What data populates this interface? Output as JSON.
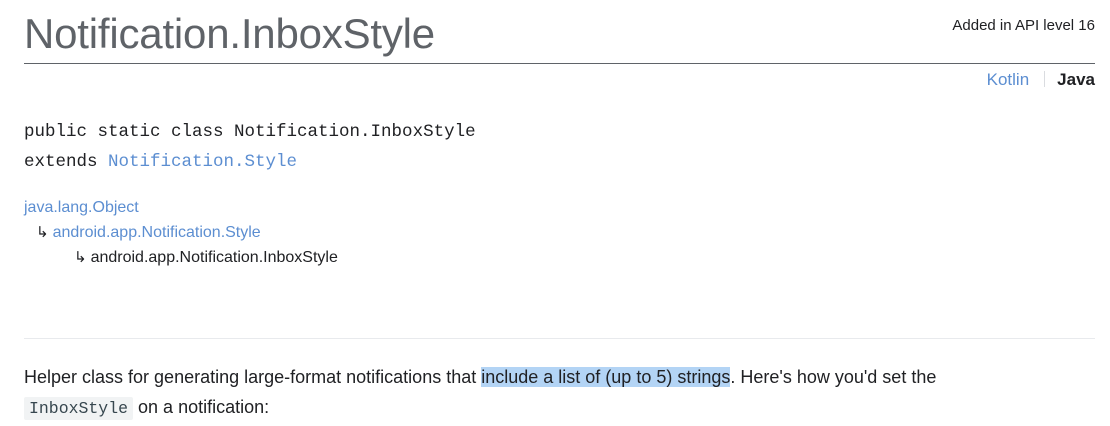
{
  "header": {
    "title": "Notification.InboxStyle",
    "api_level": "Added in API level 16"
  },
  "language_switch": {
    "kotlin": "Kotlin",
    "java": "Java",
    "selected": "Java"
  },
  "signature": {
    "declaration": "public static class Notification.InboxStyle",
    "extends_keyword": "extends ",
    "extends_class": "Notification.Style"
  },
  "hierarchy": [
    "java.lang.Object",
    "android.app.Notification.Style",
    "android.app.Notification.InboxStyle"
  ],
  "hierarchy_arrow": "↳",
  "description": {
    "text_before": "Helper class for generating large-format notifications that ",
    "highlighted": "include a list of (up to 5) strings",
    "text_after": ". Here's how you'd set the ",
    "code": "InboxStyle",
    "text_end": " on a notification:"
  },
  "colors": {
    "link": "#5c8ed1",
    "text": "#202124",
    "title": "#5f6368",
    "selection_highlight": "#b3d4f5",
    "code_background": "#f1f3f4"
  }
}
